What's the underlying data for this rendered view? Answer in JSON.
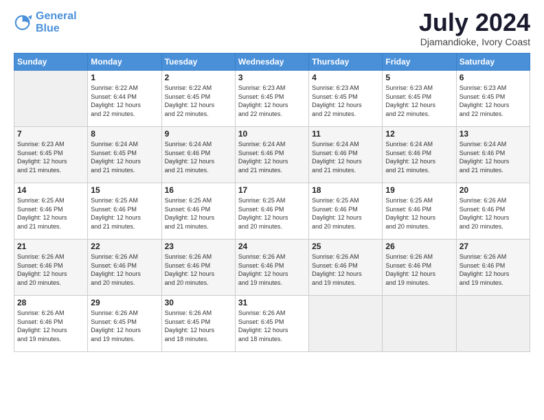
{
  "header": {
    "logo_line1": "General",
    "logo_line2": "Blue",
    "month_year": "July 2024",
    "location": "Djamandioke, Ivory Coast"
  },
  "weekdays": [
    "Sunday",
    "Monday",
    "Tuesday",
    "Wednesday",
    "Thursday",
    "Friday",
    "Saturday"
  ],
  "weeks": [
    [
      {
        "day": "",
        "info": ""
      },
      {
        "day": "1",
        "info": "Sunrise: 6:22 AM\nSunset: 6:44 PM\nDaylight: 12 hours\nand 22 minutes."
      },
      {
        "day": "2",
        "info": "Sunrise: 6:22 AM\nSunset: 6:45 PM\nDaylight: 12 hours\nand 22 minutes."
      },
      {
        "day": "3",
        "info": "Sunrise: 6:23 AM\nSunset: 6:45 PM\nDaylight: 12 hours\nand 22 minutes."
      },
      {
        "day": "4",
        "info": "Sunrise: 6:23 AM\nSunset: 6:45 PM\nDaylight: 12 hours\nand 22 minutes."
      },
      {
        "day": "5",
        "info": "Sunrise: 6:23 AM\nSunset: 6:45 PM\nDaylight: 12 hours\nand 22 minutes."
      },
      {
        "day": "6",
        "info": "Sunrise: 6:23 AM\nSunset: 6:45 PM\nDaylight: 12 hours\nand 22 minutes."
      }
    ],
    [
      {
        "day": "7",
        "info": "Sunrise: 6:23 AM\nSunset: 6:45 PM\nDaylight: 12 hours\nand 21 minutes."
      },
      {
        "day": "8",
        "info": "Sunrise: 6:24 AM\nSunset: 6:45 PM\nDaylight: 12 hours\nand 21 minutes."
      },
      {
        "day": "9",
        "info": "Sunrise: 6:24 AM\nSunset: 6:46 PM\nDaylight: 12 hours\nand 21 minutes."
      },
      {
        "day": "10",
        "info": "Sunrise: 6:24 AM\nSunset: 6:46 PM\nDaylight: 12 hours\nand 21 minutes."
      },
      {
        "day": "11",
        "info": "Sunrise: 6:24 AM\nSunset: 6:46 PM\nDaylight: 12 hours\nand 21 minutes."
      },
      {
        "day": "12",
        "info": "Sunrise: 6:24 AM\nSunset: 6:46 PM\nDaylight: 12 hours\nand 21 minutes."
      },
      {
        "day": "13",
        "info": "Sunrise: 6:24 AM\nSunset: 6:46 PM\nDaylight: 12 hours\nand 21 minutes."
      }
    ],
    [
      {
        "day": "14",
        "info": "Sunrise: 6:25 AM\nSunset: 6:46 PM\nDaylight: 12 hours\nand 21 minutes."
      },
      {
        "day": "15",
        "info": "Sunrise: 6:25 AM\nSunset: 6:46 PM\nDaylight: 12 hours\nand 21 minutes."
      },
      {
        "day": "16",
        "info": "Sunrise: 6:25 AM\nSunset: 6:46 PM\nDaylight: 12 hours\nand 21 minutes."
      },
      {
        "day": "17",
        "info": "Sunrise: 6:25 AM\nSunset: 6:46 PM\nDaylight: 12 hours\nand 20 minutes."
      },
      {
        "day": "18",
        "info": "Sunrise: 6:25 AM\nSunset: 6:46 PM\nDaylight: 12 hours\nand 20 minutes."
      },
      {
        "day": "19",
        "info": "Sunrise: 6:25 AM\nSunset: 6:46 PM\nDaylight: 12 hours\nand 20 minutes."
      },
      {
        "day": "20",
        "info": "Sunrise: 6:26 AM\nSunset: 6:46 PM\nDaylight: 12 hours\nand 20 minutes."
      }
    ],
    [
      {
        "day": "21",
        "info": "Sunrise: 6:26 AM\nSunset: 6:46 PM\nDaylight: 12 hours\nand 20 minutes."
      },
      {
        "day": "22",
        "info": "Sunrise: 6:26 AM\nSunset: 6:46 PM\nDaylight: 12 hours\nand 20 minutes."
      },
      {
        "day": "23",
        "info": "Sunrise: 6:26 AM\nSunset: 6:46 PM\nDaylight: 12 hours\nand 20 minutes."
      },
      {
        "day": "24",
        "info": "Sunrise: 6:26 AM\nSunset: 6:46 PM\nDaylight: 12 hours\nand 19 minutes."
      },
      {
        "day": "25",
        "info": "Sunrise: 6:26 AM\nSunset: 6:46 PM\nDaylight: 12 hours\nand 19 minutes."
      },
      {
        "day": "26",
        "info": "Sunrise: 6:26 AM\nSunset: 6:46 PM\nDaylight: 12 hours\nand 19 minutes."
      },
      {
        "day": "27",
        "info": "Sunrise: 6:26 AM\nSunset: 6:46 PM\nDaylight: 12 hours\nand 19 minutes."
      }
    ],
    [
      {
        "day": "28",
        "info": "Sunrise: 6:26 AM\nSunset: 6:46 PM\nDaylight: 12 hours\nand 19 minutes."
      },
      {
        "day": "29",
        "info": "Sunrise: 6:26 AM\nSunset: 6:45 PM\nDaylight: 12 hours\nand 19 minutes."
      },
      {
        "day": "30",
        "info": "Sunrise: 6:26 AM\nSunset: 6:45 PM\nDaylight: 12 hours\nand 18 minutes."
      },
      {
        "day": "31",
        "info": "Sunrise: 6:26 AM\nSunset: 6:45 PM\nDaylight: 12 hours\nand 18 minutes."
      },
      {
        "day": "",
        "info": ""
      },
      {
        "day": "",
        "info": ""
      },
      {
        "day": "",
        "info": ""
      }
    ]
  ]
}
